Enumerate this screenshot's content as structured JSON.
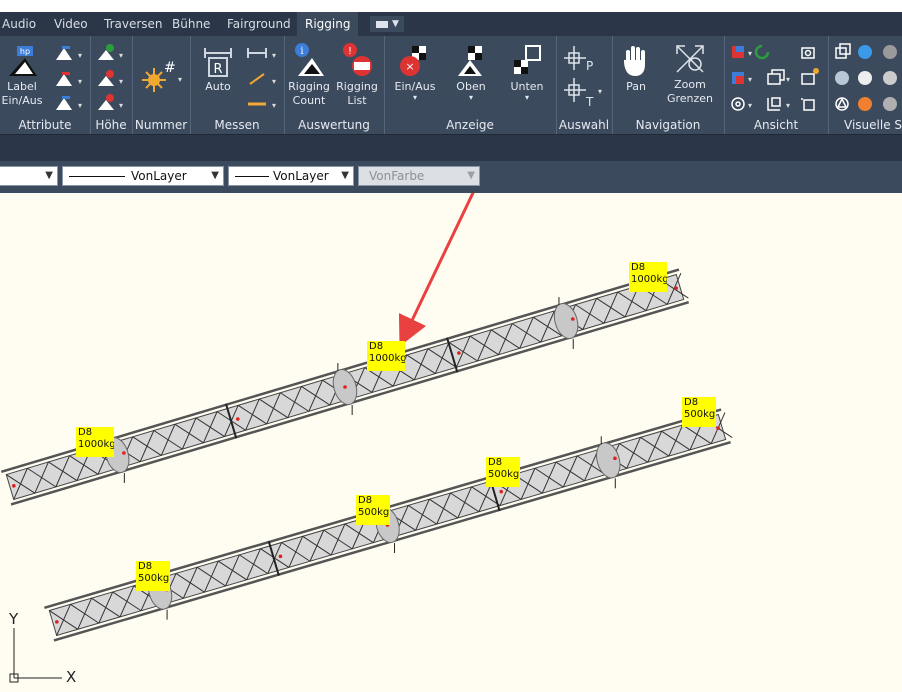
{
  "tabs": [
    "Audio",
    "Video",
    "Traversen",
    "Bühne",
    "Fairground",
    "Rigging"
  ],
  "active_tab": "Rigging",
  "ribbon": {
    "attribute": {
      "title": "Attribute",
      "label_button": "Label\nEin/Aus"
    },
    "hoehe": {
      "title": "Höhe"
    },
    "nummer": {
      "title": "Nummer"
    },
    "messen": {
      "title": "Messen",
      "auto_label": "Auto"
    },
    "auswertung": {
      "title": "Auswertung",
      "count_label": "Rigging\nCount",
      "list_label": "Rigging\nList"
    },
    "anzeige": {
      "title": "Anzeige",
      "einaus_label": "Ein/Aus",
      "oben_label": "Oben",
      "unten_label": "Unten"
    },
    "auswahl": {
      "title": "Auswahl"
    },
    "navigation": {
      "title": "Navigation",
      "pan_label": "Pan",
      "zoom_label": "Zoom\nGrenzen"
    },
    "ansicht": {
      "title": "Ansicht"
    },
    "visuelle": {
      "title": "Visuelle Sti"
    }
  },
  "properties": {
    "linetype": "VonLayer",
    "lineweight": "VonLayer",
    "plotstyle": "VonFarbe"
  },
  "canvas": {
    "tags": [
      {
        "title": "D8",
        "load": "1000kg"
      },
      {
        "title": "D8",
        "load": "1000kg"
      },
      {
        "title": "D8",
        "load": "1000kg"
      },
      {
        "title": "D8",
        "load": "500kg"
      },
      {
        "title": "D8",
        "load": "500kg"
      },
      {
        "title": "D8",
        "load": "500kg"
      },
      {
        "title": "D8",
        "load": "500kg"
      }
    ],
    "axis": {
      "x": "X",
      "y": "Y"
    }
  },
  "colors": {
    "ribbon_bg": "#3c4a5e",
    "tabbar_bg": "#2b3749",
    "canvas_bg": "#fffdf2",
    "tag_bg": "#ffff00",
    "arrow": "#e8413f"
  }
}
